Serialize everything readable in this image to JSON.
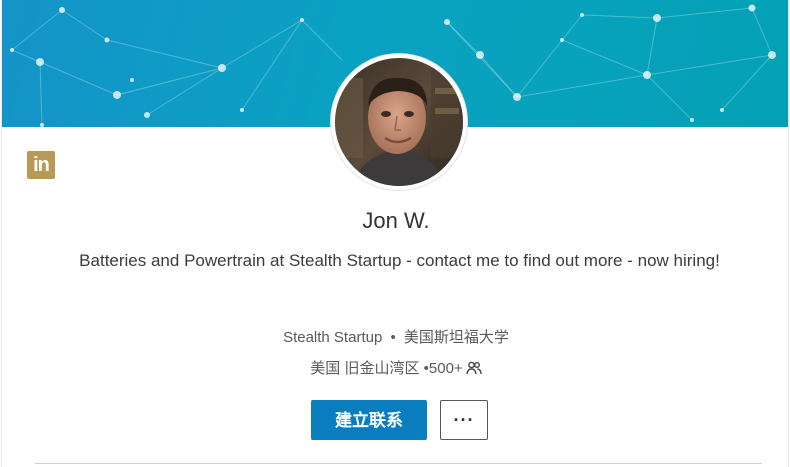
{
  "profile": {
    "name": "Jon W.",
    "headline": "Batteries and Powertrain at Stealth Startup - contact me to find out more - now hiring!",
    "company": "Stealth Startup",
    "separator": "•",
    "school": "美国斯坦福大学",
    "location": "美国 旧金山湾区",
    "connections": "•500+"
  },
  "actions": {
    "connect_label": "建立联系",
    "more_label": "···"
  },
  "brand": {
    "logo_text": "in",
    "logo_color": "#b79a58",
    "banner_color": "#0aa2c2",
    "accent": "#0a7dbf"
  }
}
